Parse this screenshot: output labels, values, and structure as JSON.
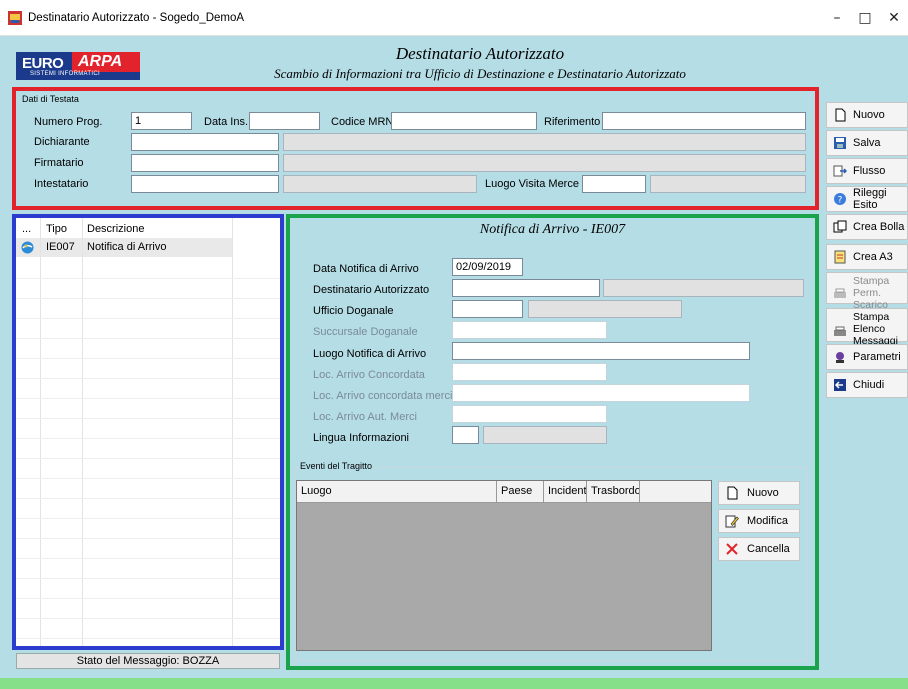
{
  "window": {
    "title": "Destinatario Autorizzato - Sogedo_DemoA",
    "minimize": "–",
    "maximize": "□",
    "close": "✕"
  },
  "header": {
    "logo_left": "EURO",
    "logo_right": "ARPA",
    "logo_sub": "SISTEMI INFORMATICI",
    "title": "Destinatario Autorizzato",
    "subtitle": "Scambio di Informazioni tra Ufficio di Destinazione e Destinatario Autorizzato"
  },
  "testata": {
    "group_label": "Dati di Testata",
    "numero_prog_label": "Numero Prog.",
    "numero_prog_value": "1",
    "data_ins_label": "Data Ins.",
    "data_ins_value": "",
    "codice_mrn_label": "Codice MRN",
    "codice_mrn_value": "",
    "riferimento_label": "Riferimento",
    "riferimento_value": "",
    "dichiarante_label": "Dichiarante",
    "firmatario_label": "Firmatario",
    "intestatario_label": "Intestatario",
    "luogo_visita_label": "Luogo Visita Merce"
  },
  "sidebar_buttons": [
    {
      "label": "Nuovo",
      "icon": "new-document-icon"
    },
    {
      "label": "Salva",
      "icon": "save-icon"
    },
    {
      "label": "Flusso",
      "icon": "flow-icon"
    },
    {
      "label": "Rileggi Esito",
      "icon": "help-icon"
    },
    {
      "label": "Crea Bolla",
      "icon": "copy-icon"
    },
    {
      "label": "Crea A3",
      "icon": "form-icon"
    },
    {
      "label": "Stampa Perm. Scarico",
      "icon": "printer-icon"
    },
    {
      "label": "Stampa Elenco Messaggi",
      "icon": "printer-icon"
    },
    {
      "label": "Parametri",
      "icon": "parameters-icon"
    },
    {
      "label": "Chiudi",
      "icon": "exit-icon"
    }
  ],
  "messages": {
    "columns": [
      "...",
      "Tipo",
      "Descrizione"
    ],
    "rows": [
      {
        "tipo": "IE007",
        "descrizione": "Notifica di Arrivo"
      }
    ],
    "status": "Stato del Messaggio: BOZZA"
  },
  "detail": {
    "title": "Notifica di Arrivo - IE007",
    "fields": {
      "data_notifica_label": "Data Notifica di Arrivo",
      "data_notifica_value": "02/09/2019",
      "destinatario_label": "Destinatario Autorizzato",
      "ufficio_label": "Ufficio Doganale",
      "succursale_label": "Succursale Doganale",
      "luogo_notifica_label": "Luogo Notifica di Arrivo",
      "loc_concordata_label": "Loc. Arrivo Concordata",
      "loc_concordata_merci_label": "Loc. Arrivo concordata merci",
      "loc_aut_merci_label": "Loc. Arrivo Aut. Merci",
      "lingua_label": "Lingua Informazioni"
    },
    "events": {
      "group_label": "Eventi del Tragitto",
      "columns": [
        "Luogo",
        "Paese",
        "Incidente",
        "Trasbordo"
      ],
      "buttons": [
        {
          "label": "Nuovo",
          "icon": "new-document-icon"
        },
        {
          "label": "Modifica",
          "icon": "edit-icon"
        },
        {
          "label": "Cancella",
          "icon": "delete-icon"
        }
      ]
    }
  }
}
